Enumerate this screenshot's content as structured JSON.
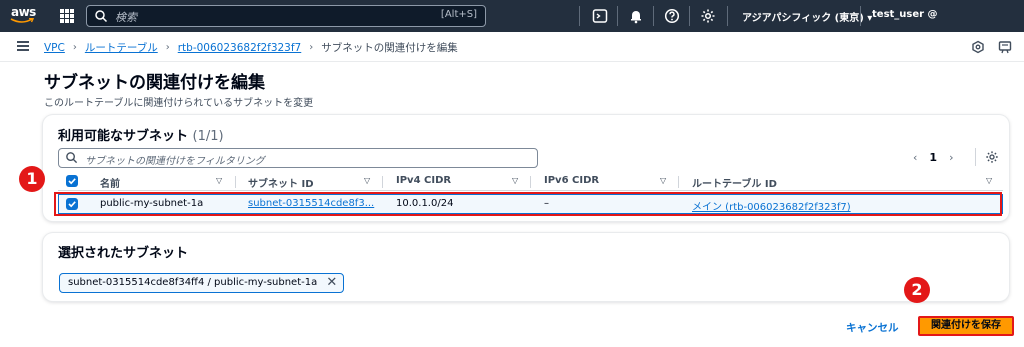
{
  "topnav": {
    "logo_text": "aws",
    "search_placeholder": "検索",
    "search_shortcut": "[Alt+S]",
    "region": "アジアパシフィック (東京) ▾",
    "user": "test_user @",
    "icons": [
      "apps-grid-icon",
      "search-icon",
      "cloudshell-icon",
      "bell-icon",
      "help-icon",
      "gear-icon"
    ],
    "bg_color": "#232f3e"
  },
  "breadcrumb": {
    "items": [
      "VPC",
      "ルートテーブル",
      "rtb-006023682f2f323f7"
    ],
    "current": "サブネットの関連付けを編集",
    "separator": "›"
  },
  "page": {
    "title": "サブネットの関連付けを編集",
    "description": "このルートテーブルに関連付けられているサブネットを変更"
  },
  "available": {
    "title": "利用可能なサブネット",
    "count": "(1/1)",
    "filter_placeholder": "サブネットの関連付けをフィルタリング",
    "page_number": "1",
    "prev": "‹",
    "next": "›",
    "columns": [
      "名前",
      "サブネット ID",
      "IPv4 CIDR",
      "IPv6 CIDR",
      "ルートテーブル ID"
    ],
    "rows": [
      {
        "checked": true,
        "name": "public-my-subnet-1a",
        "subnet_id": "subnet-0315514cde8f3...",
        "ipv4": "10.0.1.0/24",
        "ipv6": "–",
        "route_table": "メイン (rtb-006023682f2f323f7)"
      }
    ]
  },
  "selected": {
    "title": "選択されたサブネット",
    "token": "subnet-0315514cde8f34ff4 / public-my-subnet-1a",
    "remove": "✕"
  },
  "actions": {
    "cancel": "キャンセル",
    "save": "関連付けを保存"
  },
  "annotations": {
    "marker1": "1",
    "marker2": "2",
    "color": "#e31818"
  },
  "colors": {
    "link": "#0972d3",
    "primary_button": "#ff9900"
  }
}
